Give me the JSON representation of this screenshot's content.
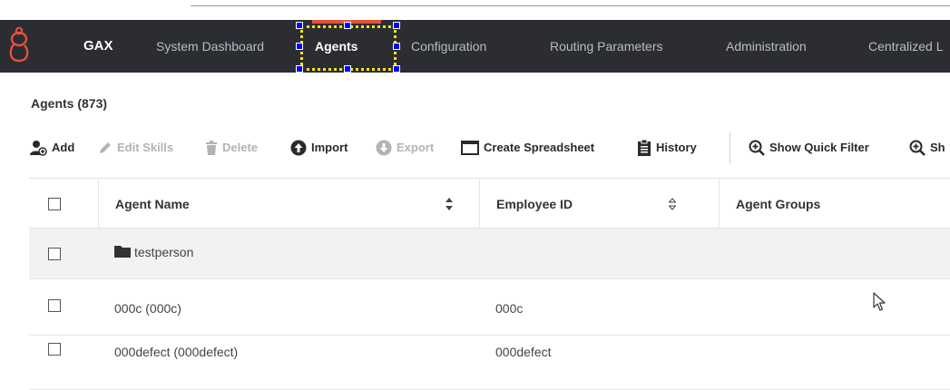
{
  "app": {
    "brand": "GAX",
    "nav": [
      {
        "label": "System Dashboard",
        "active": false
      },
      {
        "label": "Agents",
        "active": true
      },
      {
        "label": "Configuration",
        "active": false
      },
      {
        "label": "Routing Parameters",
        "active": false
      },
      {
        "label": "Administration",
        "active": false
      },
      {
        "label": "Centralized L",
        "active": false
      }
    ],
    "accent": "#e8503a"
  },
  "page": {
    "title": "Agents (873)"
  },
  "toolbar": {
    "add": "Add",
    "edit_skills": "Edit Skills",
    "delete": "Delete",
    "import": "Import",
    "export": "Export",
    "create_spreadsheet": "Create Spreadsheet",
    "history": "History",
    "show_quick_filter": "Show Quick Filter",
    "show_more": "Sh"
  },
  "table": {
    "columns": [
      "Agent Name",
      "Employee ID",
      "Agent Groups"
    ],
    "rows": [
      {
        "name": "testperson",
        "employee_id": "",
        "groups": "",
        "is_folder": true
      },
      {
        "name": "000c (000c)",
        "employee_id": "000c",
        "groups": "",
        "is_folder": false
      },
      {
        "name": "000defect (000defect)",
        "employee_id": "000defect",
        "groups": "",
        "is_folder": false
      }
    ]
  }
}
